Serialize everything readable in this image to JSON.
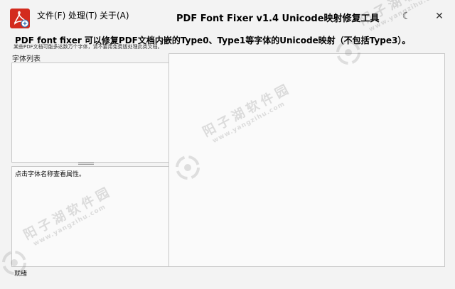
{
  "menu": {
    "file": "文件(F)",
    "process": "处理(T)",
    "about": "关于(A)"
  },
  "window": {
    "title": "PDF Font Fixer v1.4  Unicode映射修复工具",
    "theme_icon": "moon-icon",
    "close_icon": "close-icon"
  },
  "header": {
    "headline": "PDF font fixer 可以修复PDF文档内嵌的Type0、Type1等字体的Unicode映射（不包括Type3）。",
    "subline": "某些PDF文档可能多达数万个字体，请不要用免费版处理此类文档。"
  },
  "font_list": {
    "label": "字体列表"
  },
  "properties": {
    "hint": "点击字体名称查看属性。"
  },
  "status_bar": {
    "text": "就绪"
  },
  "watermark": {
    "name": "阳子湖软件园",
    "url": "www.yangzihu.com"
  },
  "colors": {
    "app_icon": "#d32b1e",
    "window_bg": "#f3f3f3",
    "panel_bg": "#fafafa",
    "panel_border": "#c8c8c8"
  }
}
